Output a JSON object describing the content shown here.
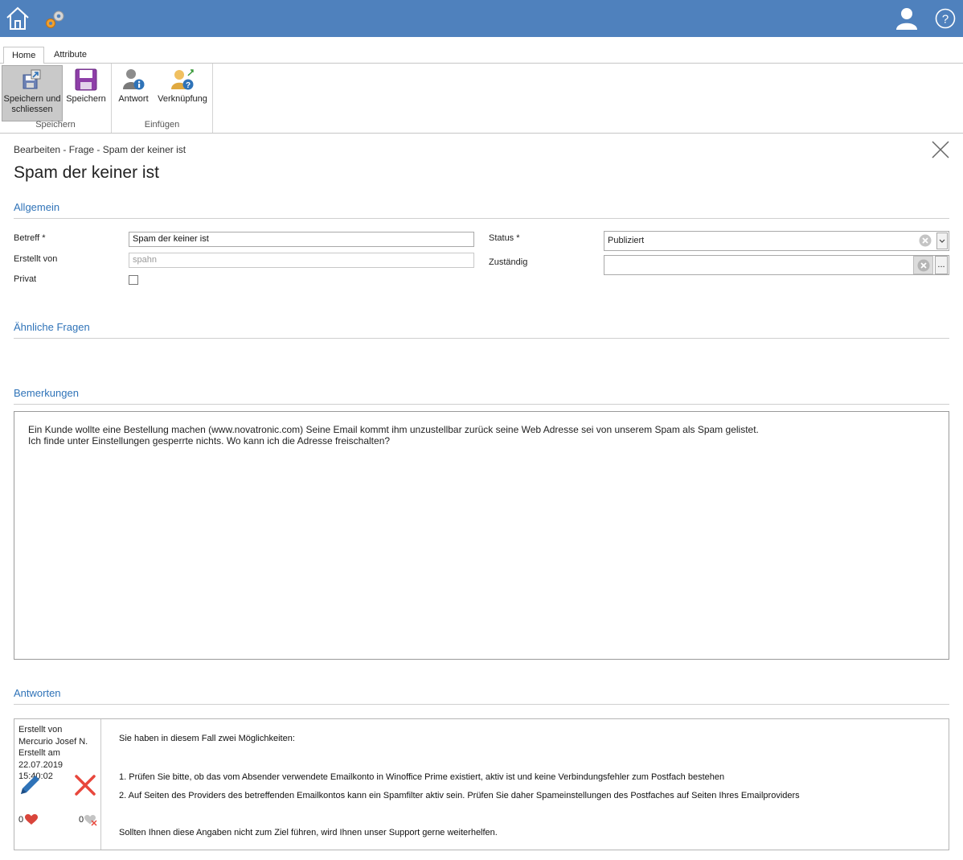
{
  "ribbon": {
    "tabs": [
      "Home",
      "Attribute"
    ],
    "groups": [
      {
        "label": "Speichern",
        "buttons": [
          "Speichern und schliessen",
          "Speichern"
        ]
      },
      {
        "label": "Einfügen",
        "buttons": [
          "Antwort",
          "Verknüpfung"
        ]
      }
    ]
  },
  "header": {
    "breadcrumb": "Bearbeiten - Frage - Spam der keiner ist",
    "title": "Spam der keiner ist"
  },
  "sections": {
    "general": "Allgemein",
    "similar": "Ähnliche Fragen",
    "remarks": "Bemerkungen",
    "answers": "Antworten"
  },
  "form": {
    "subject_label": "Betreff *",
    "subject_value": "Spam der keiner ist",
    "created_by_label": "Erstellt von",
    "created_by_value": "spahn",
    "private_label": "Privat",
    "private_checked": false,
    "status_label": "Status *",
    "status_value": "Publiziert",
    "responsible_label": "Zuständig",
    "responsible_value": "",
    "dots_label": "..."
  },
  "remarks": {
    "line1": "Ein Kunde wollte eine Bestellung machen (www.novatronic.com) Seine Email kommt ihm unzustellbar zurück seine Web Adresse sei von unserem Spam als Spam gelistet.",
    "line2": "Ich finde unter Einstellungen gesperrte nichts. Wo kann ich die Adresse freischalten?"
  },
  "answers": [
    {
      "created_by_label": "Erstellt von",
      "created_by": "Mercurio Josef N.",
      "created_at_label": "Erstellt am",
      "created_at": "22.07.2019 15:40:02",
      "likes": "0",
      "dislikes": "0",
      "text": {
        "intro": "Sie haben in diesem Fall zwei Möglichkeiten:",
        "point1": "1. Prüfen Sie bitte, ob das vom Absender verwendete Emailkonto in Winoffice Prime existiert, aktiv ist und keine Verbindungsfehler zum Postfach bestehen",
        "point2": "2. Auf Seiten des Providers des betreffenden Emailkontos kann ein Spamfilter aktiv sein. Prüfen Sie daher Spameinstellungen des Postfaches auf Seiten Ihres Emailproviders",
        "outro": "Sollten Ihnen diese Angaben nicht zum Ziel führen, wird Ihnen unser Support gerne weiterhelfen."
      }
    }
  ],
  "colors": {
    "topbar": "#4f81bd",
    "accent": "#2f73b8",
    "like": "#d9453b",
    "delete": "#e8473c",
    "edit": "#2f73b8"
  }
}
